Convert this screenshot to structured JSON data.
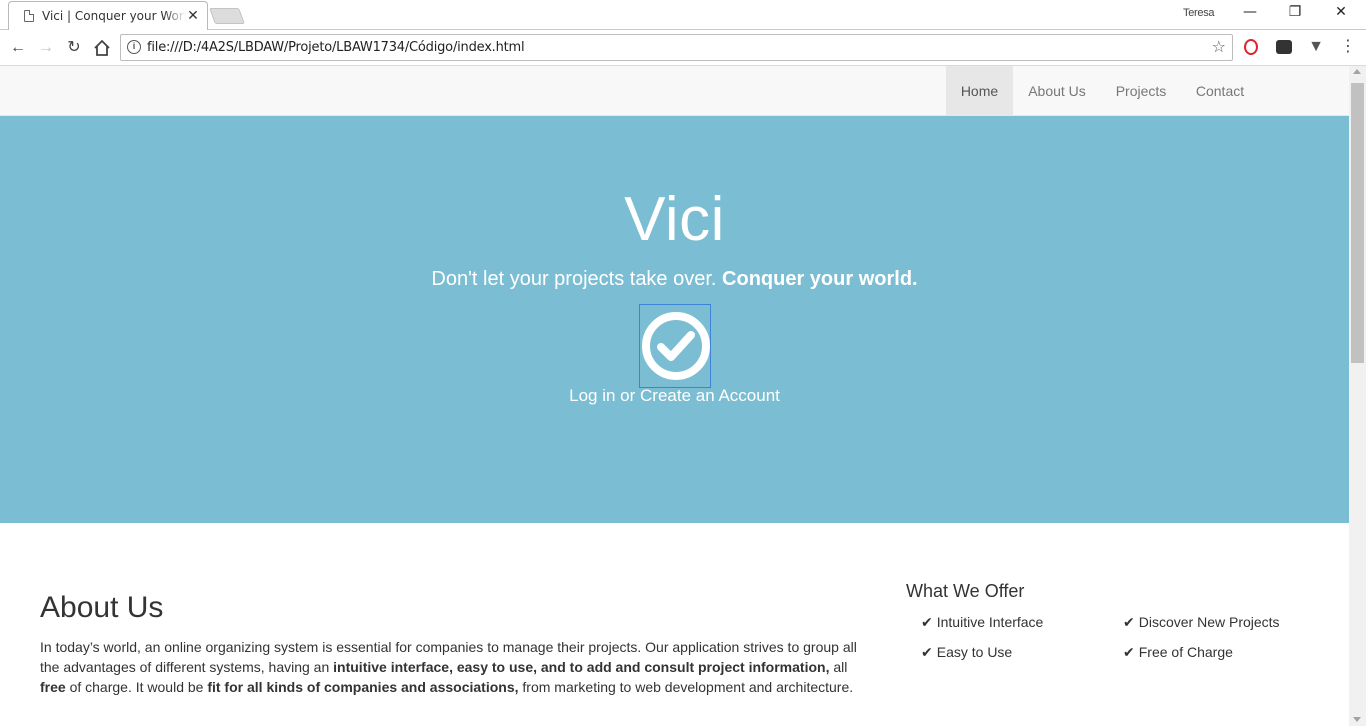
{
  "browser": {
    "tab_title": "Vici | Conquer your World",
    "tab_close": "✕",
    "profile_name": "Teresa",
    "url": "file:///D:/4A2S/LBDAW/Projeto/LBAW1734/Código/index.html",
    "icons": [
      "back-icon",
      "forward-icon",
      "reload-icon",
      "home-icon",
      "info-icon",
      "star-icon",
      "opera-icon",
      "extension-icon",
      "vivaldi-icon",
      "menu-icon"
    ]
  },
  "nav": {
    "items": [
      {
        "label": "Home",
        "active": true
      },
      {
        "label": "About Us",
        "active": false
      },
      {
        "label": "Projects",
        "active": false
      },
      {
        "label": "Contact",
        "active": false
      }
    ]
  },
  "hero": {
    "title": "Vici",
    "subtitle_plain": "Don't let your projects take over. ",
    "subtitle_bold": "Conquer your world.",
    "cta_label": "Log in or Create an Account",
    "bg_color": "#7bbdd3"
  },
  "about": {
    "heading": "About Us",
    "p1": "In today’s world, an online organizing system is essential for companies to manage their projects. Our application strives to group all the advantages of different systems, having an ",
    "b1": "intuitive interface, easy to use, and to add and consult project information,",
    "p2": " all ",
    "b2": "free",
    "p3": " of charge. It would be ",
    "b3": "fit for all kinds of companies and associations,",
    "p4": " from marketing to web development and architecture."
  },
  "offer": {
    "heading": "What We Offer",
    "items": [
      "Intuitive Interface",
      "Discover New Projects",
      "Easy to Use",
      "Free of Charge"
    ]
  }
}
